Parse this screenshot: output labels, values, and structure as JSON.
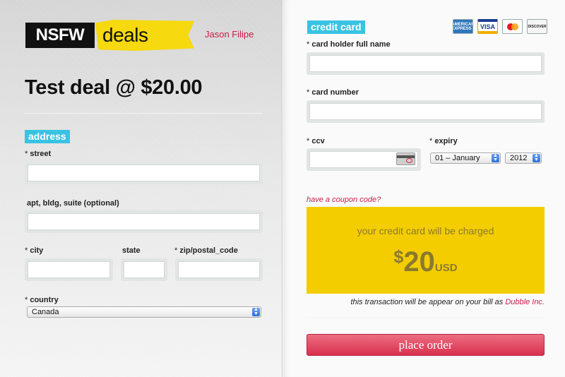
{
  "brand": {
    "part1": "NSFW",
    "part2": "deals"
  },
  "user": {
    "name": "Jason Filipe"
  },
  "deal": {
    "title": "Test deal @ $20.00"
  },
  "address": {
    "section_label": "address",
    "street_label": "street",
    "apt_label": "apt, bldg, suite (optional)",
    "city_label": "city",
    "state_label": "state",
    "zip_label": "zip/postal_code",
    "country_label": "country",
    "country_value": "Canada",
    "required_marker": "*"
  },
  "credit_card": {
    "section_label": "credit card",
    "holder_label": "card holder full name",
    "number_label": "card number",
    "ccv_label": "ccv",
    "expiry_label": "expiry",
    "expiry_month": "01 – January",
    "expiry_year": "2012",
    "card_types": [
      {
        "name": "amex-icon",
        "text": "AMERICAN EXPRESS"
      },
      {
        "name": "visa-icon",
        "text": "VISA"
      },
      {
        "name": "mastercard-icon",
        "text": ""
      },
      {
        "name": "discover-icon",
        "text": "DISCOVER"
      }
    ]
  },
  "coupon": {
    "link": "have a coupon code?"
  },
  "charge": {
    "text": "your credit card will be charged",
    "currency_symbol": "$",
    "amount": "20",
    "currency": "USD",
    "note_prefix": "this transaction will be appear on your bill as",
    "company": "Dubble Inc."
  },
  "actions": {
    "place_order": "place order"
  },
  "colors": {
    "accent_blue": "#39c3e3",
    "brand_yellow": "#f6d90e",
    "charge_yellow": "#f4cd00",
    "link_red": "#cc1b4a",
    "button_red": "#d9304d"
  }
}
